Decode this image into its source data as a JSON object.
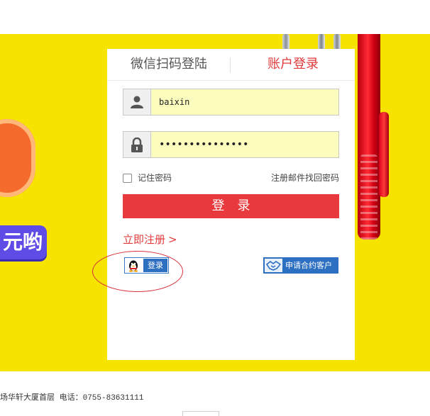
{
  "promo": {
    "partial_text": "元哟",
    "number_color": "#f46b2d",
    "pill_color": "#5f4be6"
  },
  "colors": {
    "banner": "#f6e300",
    "accent_red": "#e8393c",
    "qq_blue": "#2d6fc1"
  },
  "login": {
    "tabs": {
      "wechat_label": "微信扫码登陆",
      "account_label": "账户登录",
      "active": "account"
    },
    "username": {
      "value": "baixin",
      "icon": "user-icon"
    },
    "password": {
      "masked_value": "•••••••••••••••",
      "icon": "lock-icon"
    },
    "remember_label": "记住密码",
    "remember_checked": false,
    "forgot_link": "注册邮件找回密码",
    "submit_label": "登录",
    "register_link": "立即注册",
    "register_chevron": ">",
    "qq_login": {
      "icon": "qq-penguin-icon",
      "label": "登录"
    },
    "contract_apply": {
      "icon": "handshake-icon",
      "label": "申请合约客户"
    }
  },
  "footer": {
    "text": "场华轩大厦首层 电话：0755-83631111"
  }
}
